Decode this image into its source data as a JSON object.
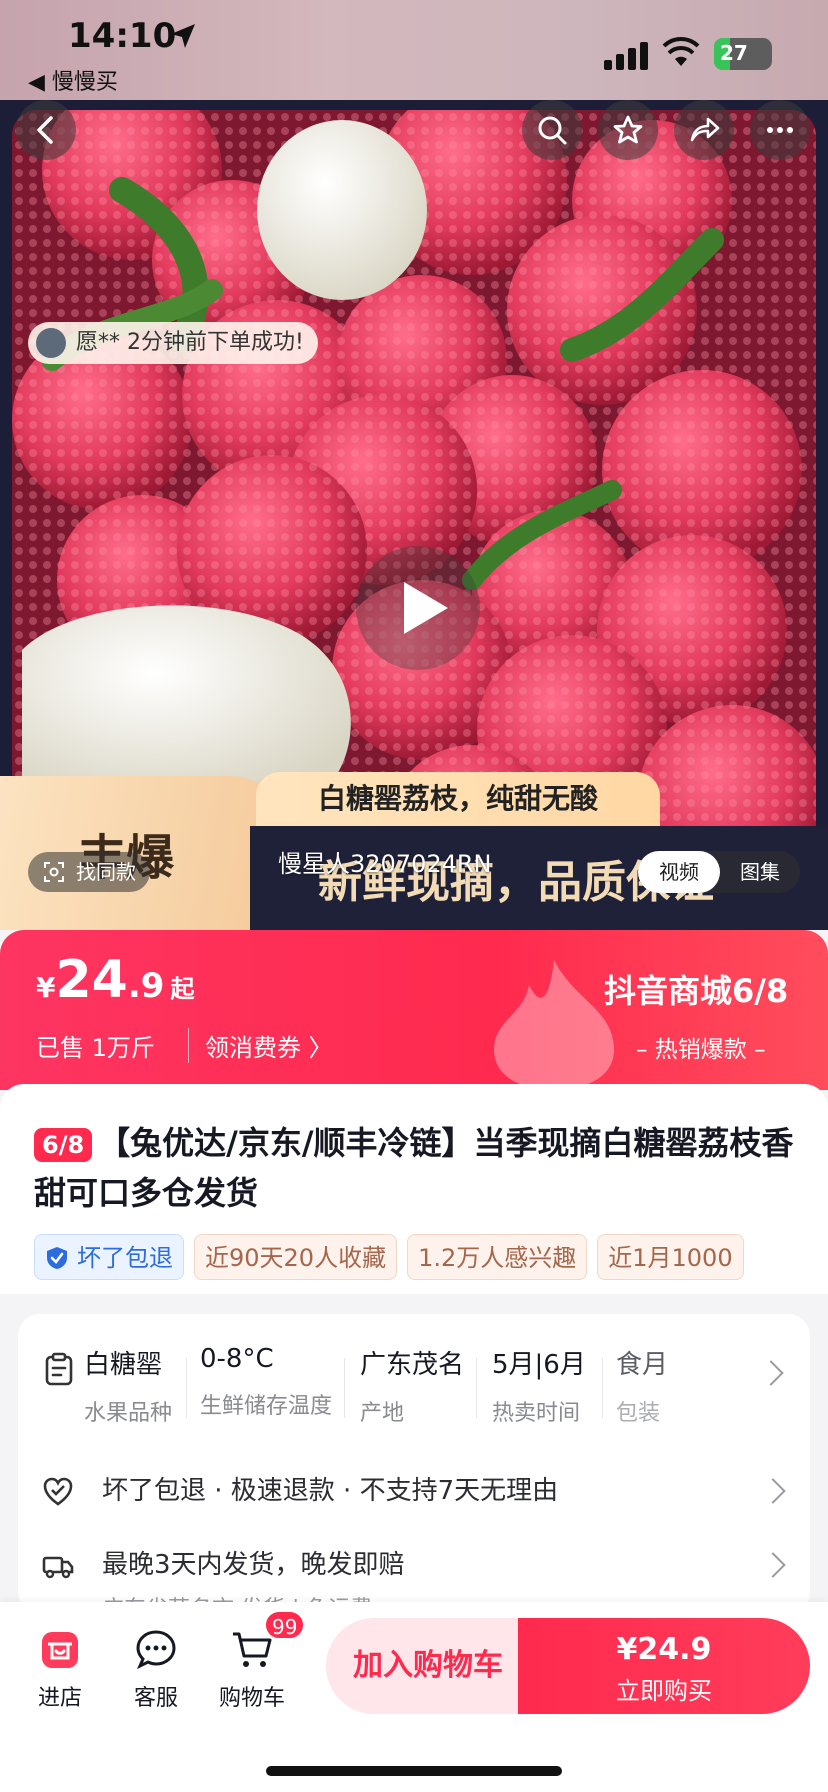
{
  "status_bar": {
    "time": "14:10",
    "back_app": "◀ 慢慢买",
    "battery": "27"
  },
  "hero": {
    "order_notice": "愿** 2分钟前下单成功!",
    "slogan": "白糖罂荔枝，纯甜无酸",
    "band_text": "新鲜现摘，品质保证",
    "hot_label": "丰爆",
    "seller_watermark": "慢星人3207024RN",
    "find_similar": "找同款",
    "media_tabs": [
      "视频",
      "图集"
    ],
    "active_media_tab": "视频"
  },
  "price": {
    "currency": "¥",
    "integer": "24",
    "decimal": ".9",
    "suffix": "起",
    "sold": "已售 1万斤",
    "coupon": "领消费券 〉",
    "brand": "抖音商城6/8",
    "hot_tag": "– 热销爆款 –"
  },
  "product": {
    "tag": "6/8",
    "title": "【兔优达/京东/顺丰冷链】当季现摘白糖罂荔枝香甜可口多仓发货",
    "chips": [
      "坏了包退",
      "近90天20人收藏",
      "1.2万人感兴趣",
      "近1月1000"
    ]
  },
  "specs": [
    {
      "value": "白糖罂",
      "key": "水果品种"
    },
    {
      "value": "0-8°C",
      "key": "生鲜储存温度"
    },
    {
      "value": "广东茂名",
      "key": "产地"
    },
    {
      "value": "5月|6月",
      "key": "热卖时间"
    },
    {
      "value": "食月",
      "key": "包装"
    }
  ],
  "services": {
    "guarantee": "坏了包退 · 极速退款 · 不支持7天无理由",
    "shipping": "最晚3天内发货，晚发即赔",
    "shipping_sub": "广东省茂名市 发货 | 免运费"
  },
  "bottom_bar": {
    "store": "进店",
    "service": "客服",
    "cart": "购物车",
    "cart_badge": "99",
    "add_to_cart": "加入购物车",
    "buy_price": "¥24.9",
    "buy_label": "立即购买"
  },
  "colors": {
    "accent": "#ff2a4e",
    "gold": "#f3dcb5",
    "navy": "#1f2139"
  }
}
